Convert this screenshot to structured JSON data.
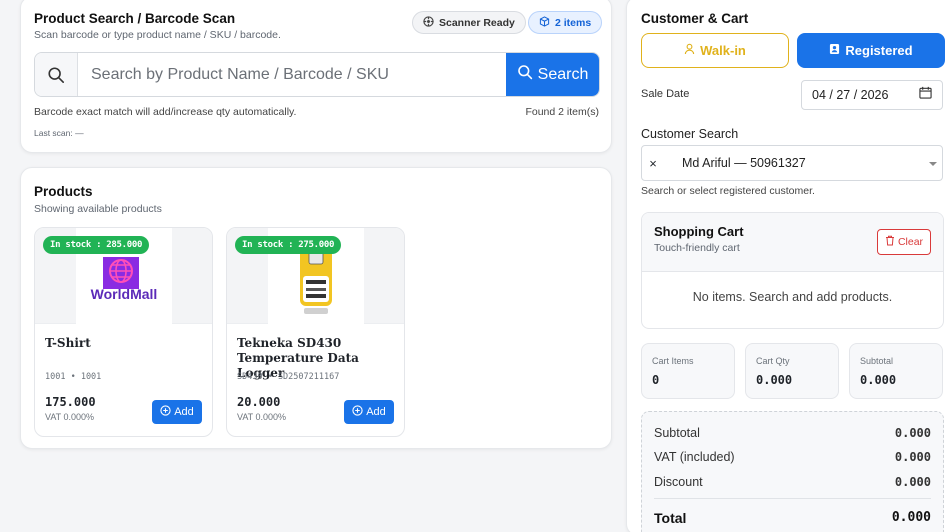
{
  "search": {
    "title": "Product Search / Barcode Scan",
    "subtitle": "Scan barcode or type product name / SKU / barcode.",
    "scanner_status": "Scanner Ready",
    "items_badge": "2 items",
    "placeholder": "Search by Product Name / Barcode / SKU",
    "button_label": "Search",
    "hint": "Barcode exact match will add/increase qty automatically.",
    "found": "Found 2 item(s)",
    "last_scan": "Last scan: —"
  },
  "products": {
    "title": "Products",
    "subtitle": "Showing available products",
    "add_label": "Add",
    "items": [
      {
        "stock": "In stock : 285.000",
        "name": "T-Shirt",
        "sku": "1001 • 1001",
        "price": "175.000",
        "vat": "VAT 0.000%",
        "image_text": "WorldMall",
        "image_icon": "globe-logo"
      },
      {
        "stock": "In stock : 275.000",
        "name": "Tekneka SD430 Temperature Data Logger",
        "sku": "SD430 • SD2507211167",
        "price": "20.000",
        "vat": "VAT 0.000%",
        "image_icon": "data-logger-device"
      }
    ]
  },
  "customer": {
    "title": "Customer & Cart",
    "walkin_label": "Walk-in",
    "registered_label": "Registered",
    "sale_date_label": "Sale Date",
    "sale_date_value": "04 / 27 / 2026",
    "search_label": "Customer Search",
    "selected_customer": "Md Ariful — 50961327",
    "clear_x": "×",
    "search_hint": "Search or select registered customer."
  },
  "cart": {
    "title": "Shopping Cart",
    "subtitle": "Touch-friendly cart",
    "clear_label": "Clear",
    "empty_text": "No items. Search and add products.",
    "stats": [
      {
        "label": "Cart Items",
        "value": "0"
      },
      {
        "label": "Cart Qty",
        "value": "0.000"
      },
      {
        "label": "Subtotal",
        "value": "0.000"
      }
    ],
    "summary": [
      {
        "label": "Subtotal",
        "value": "0.000"
      },
      {
        "label": "VAT (included)",
        "value": "0.000"
      },
      {
        "label": "Discount",
        "value": "0.000"
      }
    ],
    "total_label": "Total",
    "total_value": "0.000"
  },
  "colors": {
    "primary": "#1a73e8",
    "stock_green": "#21b355",
    "walkin_yellow": "#e0b21c",
    "danger": "#d93a3a"
  }
}
